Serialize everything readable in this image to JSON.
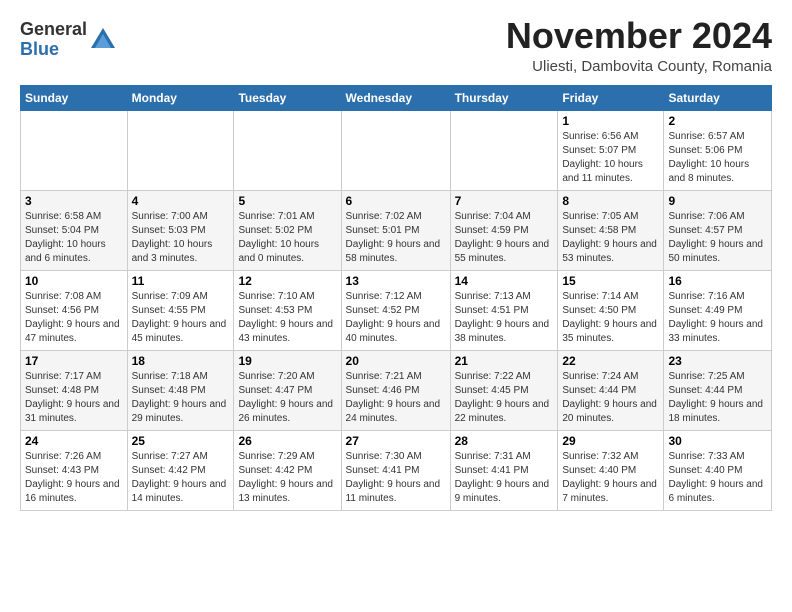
{
  "logo": {
    "general": "General",
    "blue": "Blue"
  },
  "header": {
    "title": "November 2024",
    "subtitle": "Uliesti, Dambovita County, Romania"
  },
  "columns": [
    "Sunday",
    "Monday",
    "Tuesday",
    "Wednesday",
    "Thursday",
    "Friday",
    "Saturday"
  ],
  "weeks": [
    [
      {
        "day": "",
        "info": ""
      },
      {
        "day": "",
        "info": ""
      },
      {
        "day": "",
        "info": ""
      },
      {
        "day": "",
        "info": ""
      },
      {
        "day": "",
        "info": ""
      },
      {
        "day": "1",
        "info": "Sunrise: 6:56 AM\nSunset: 5:07 PM\nDaylight: 10 hours and 11 minutes."
      },
      {
        "day": "2",
        "info": "Sunrise: 6:57 AM\nSunset: 5:06 PM\nDaylight: 10 hours and 8 minutes."
      }
    ],
    [
      {
        "day": "3",
        "info": "Sunrise: 6:58 AM\nSunset: 5:04 PM\nDaylight: 10 hours and 6 minutes."
      },
      {
        "day": "4",
        "info": "Sunrise: 7:00 AM\nSunset: 5:03 PM\nDaylight: 10 hours and 3 minutes."
      },
      {
        "day": "5",
        "info": "Sunrise: 7:01 AM\nSunset: 5:02 PM\nDaylight: 10 hours and 0 minutes."
      },
      {
        "day": "6",
        "info": "Sunrise: 7:02 AM\nSunset: 5:01 PM\nDaylight: 9 hours and 58 minutes."
      },
      {
        "day": "7",
        "info": "Sunrise: 7:04 AM\nSunset: 4:59 PM\nDaylight: 9 hours and 55 minutes."
      },
      {
        "day": "8",
        "info": "Sunrise: 7:05 AM\nSunset: 4:58 PM\nDaylight: 9 hours and 53 minutes."
      },
      {
        "day": "9",
        "info": "Sunrise: 7:06 AM\nSunset: 4:57 PM\nDaylight: 9 hours and 50 minutes."
      }
    ],
    [
      {
        "day": "10",
        "info": "Sunrise: 7:08 AM\nSunset: 4:56 PM\nDaylight: 9 hours and 47 minutes."
      },
      {
        "day": "11",
        "info": "Sunrise: 7:09 AM\nSunset: 4:55 PM\nDaylight: 9 hours and 45 minutes."
      },
      {
        "day": "12",
        "info": "Sunrise: 7:10 AM\nSunset: 4:53 PM\nDaylight: 9 hours and 43 minutes."
      },
      {
        "day": "13",
        "info": "Sunrise: 7:12 AM\nSunset: 4:52 PM\nDaylight: 9 hours and 40 minutes."
      },
      {
        "day": "14",
        "info": "Sunrise: 7:13 AM\nSunset: 4:51 PM\nDaylight: 9 hours and 38 minutes."
      },
      {
        "day": "15",
        "info": "Sunrise: 7:14 AM\nSunset: 4:50 PM\nDaylight: 9 hours and 35 minutes."
      },
      {
        "day": "16",
        "info": "Sunrise: 7:16 AM\nSunset: 4:49 PM\nDaylight: 9 hours and 33 minutes."
      }
    ],
    [
      {
        "day": "17",
        "info": "Sunrise: 7:17 AM\nSunset: 4:48 PM\nDaylight: 9 hours and 31 minutes."
      },
      {
        "day": "18",
        "info": "Sunrise: 7:18 AM\nSunset: 4:48 PM\nDaylight: 9 hours and 29 minutes."
      },
      {
        "day": "19",
        "info": "Sunrise: 7:20 AM\nSunset: 4:47 PM\nDaylight: 9 hours and 26 minutes."
      },
      {
        "day": "20",
        "info": "Sunrise: 7:21 AM\nSunset: 4:46 PM\nDaylight: 9 hours and 24 minutes."
      },
      {
        "day": "21",
        "info": "Sunrise: 7:22 AM\nSunset: 4:45 PM\nDaylight: 9 hours and 22 minutes."
      },
      {
        "day": "22",
        "info": "Sunrise: 7:24 AM\nSunset: 4:44 PM\nDaylight: 9 hours and 20 minutes."
      },
      {
        "day": "23",
        "info": "Sunrise: 7:25 AM\nSunset: 4:44 PM\nDaylight: 9 hours and 18 minutes."
      }
    ],
    [
      {
        "day": "24",
        "info": "Sunrise: 7:26 AM\nSunset: 4:43 PM\nDaylight: 9 hours and 16 minutes."
      },
      {
        "day": "25",
        "info": "Sunrise: 7:27 AM\nSunset: 4:42 PM\nDaylight: 9 hours and 14 minutes."
      },
      {
        "day": "26",
        "info": "Sunrise: 7:29 AM\nSunset: 4:42 PM\nDaylight: 9 hours and 13 minutes."
      },
      {
        "day": "27",
        "info": "Sunrise: 7:30 AM\nSunset: 4:41 PM\nDaylight: 9 hours and 11 minutes."
      },
      {
        "day": "28",
        "info": "Sunrise: 7:31 AM\nSunset: 4:41 PM\nDaylight: 9 hours and 9 minutes."
      },
      {
        "day": "29",
        "info": "Sunrise: 7:32 AM\nSunset: 4:40 PM\nDaylight: 9 hours and 7 minutes."
      },
      {
        "day": "30",
        "info": "Sunrise: 7:33 AM\nSunset: 4:40 PM\nDaylight: 9 hours and 6 minutes."
      }
    ]
  ]
}
